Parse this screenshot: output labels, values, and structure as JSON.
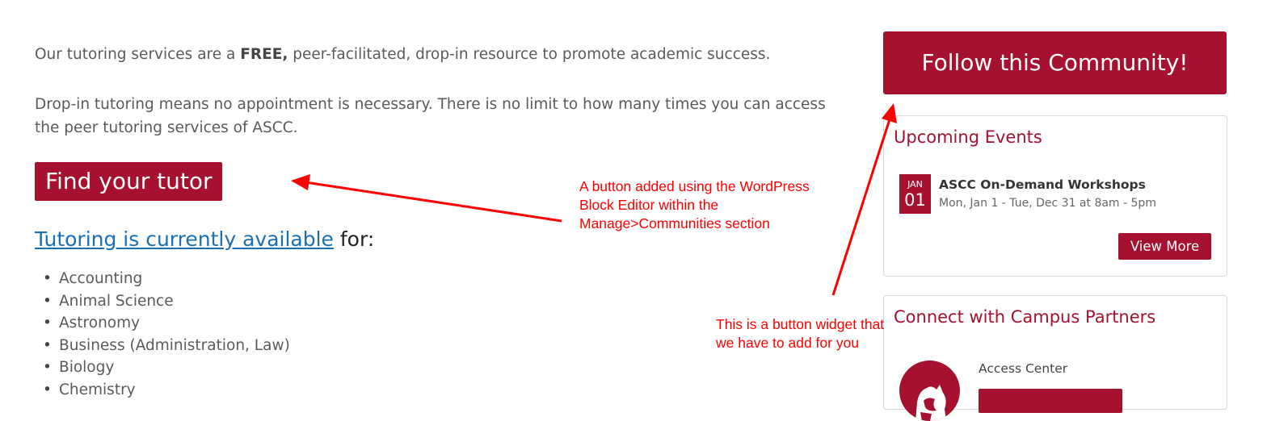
{
  "intro": {
    "p1_before": "Our tutoring services are a ",
    "p1_bold": "FREE,",
    "p1_after": " peer-facilitated, drop-in resource to promote academic success.",
    "p2": "Drop-in tutoring means no appointment is necessary. There is no limit to how many times you can access the peer tutoring services of ASCC."
  },
  "find_tutor_button": "Find your tutor",
  "availability": {
    "link": "Tutoring is currently available",
    "suffix": " for:"
  },
  "subjects": [
    "Accounting",
    "Animal Science",
    "Astronomy",
    "Business (Administration, Law)",
    "Biology",
    "Chemistry"
  ],
  "annotations": {
    "block_editor": "A button added using the WordPress Block Editor within the Manage>Communities section",
    "widget": "This is a button widget that we have to add for you"
  },
  "sidebar": {
    "follow_button": "Follow this Community!",
    "events": {
      "title": "Upcoming Events",
      "date_month": "JAN",
      "date_day": "01",
      "event_title": "ASCC On-Demand Workshops",
      "event_time": "Mon, Jan 1 - Tue, Dec 31 at 8am - 5pm",
      "view_more": "View More"
    },
    "partners": {
      "title": "Connect with Campus Partners",
      "partner_name": "Access Center",
      "logo_icon": "cougar-head-icon"
    }
  },
  "colors": {
    "brand": "#a6112f",
    "link": "#1a6fb5",
    "annotation": "#ff0000"
  }
}
